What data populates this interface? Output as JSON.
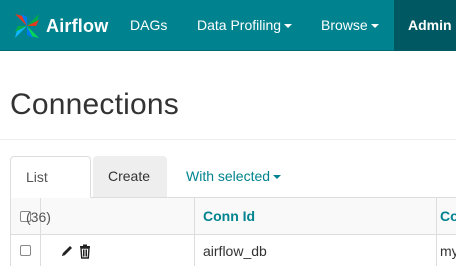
{
  "navbar": {
    "brand": "Airflow",
    "items": [
      {
        "label": "DAGs",
        "has_caret": false
      },
      {
        "label": "Data Profiling",
        "has_caret": true
      },
      {
        "label": "Browse",
        "has_caret": true
      },
      {
        "label": "Admin",
        "has_caret": true,
        "active": true
      }
    ]
  },
  "page": {
    "title": "Connections"
  },
  "tabs": {
    "list_label": "List (36)",
    "create_label": "Create",
    "with_selected_label": "With selected"
  },
  "table": {
    "columns": [
      "Conn Id",
      "Co"
    ],
    "rows": [
      {
        "conn_id": "airflow_db",
        "conn_type": "my"
      }
    ]
  },
  "colors": {
    "navbar": "#00838f",
    "navbar_active": "#005962",
    "link": "#00838f"
  },
  "icons": [
    "pinwheel-logo-icon",
    "caret-down-icon",
    "pencil-icon",
    "trash-icon"
  ]
}
